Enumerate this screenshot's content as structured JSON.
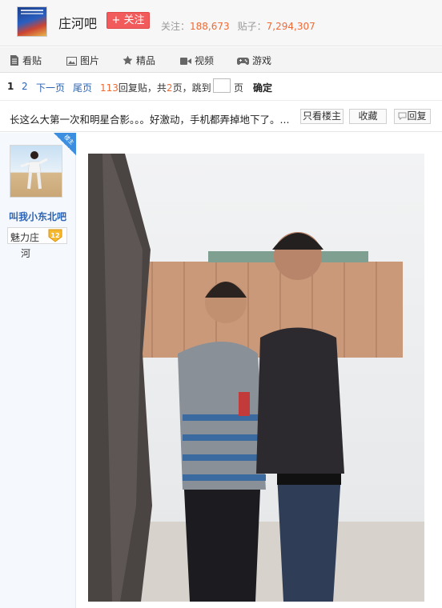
{
  "header": {
    "forum_name": "庄河吧",
    "follow_label": "+ 关注",
    "follow_count_label": "关注：",
    "follow_count": "188,673",
    "post_count_label": "贴子：",
    "post_count": "7,294,307"
  },
  "nav": {
    "items": [
      {
        "label": "看贴",
        "icon": "document-icon"
      },
      {
        "label": "图片",
        "icon": "image-icon"
      },
      {
        "label": "精品",
        "icon": "star-icon"
      },
      {
        "label": "视频",
        "icon": "video-camera-icon"
      },
      {
        "label": "游戏",
        "icon": "gamepad-icon"
      }
    ]
  },
  "pager": {
    "current_page": "1",
    "page_2": "2",
    "next_page": "下一页",
    "last_page": "尾页",
    "reply_count": "113",
    "reply_text": "回复贴，共",
    "total_pages": "2",
    "jump_text": "页，跳到",
    "page_unit": "页",
    "confirm": "确定"
  },
  "thread": {
    "title": "长这么大第一次和明星合影。。。好激动，手机都弄掉地下了。...",
    "only_op_label": "只看楼主",
    "favorite_label": "收藏",
    "reply_label": "回复"
  },
  "author": {
    "louzhu_tag": "楼主",
    "name": "叫我小东北吧",
    "level_name_line1": "魅力庄",
    "level_name_line2": "河",
    "level": "12"
  },
  "colors": {
    "accent_red": "#f25b5b",
    "link_blue": "#2d64b3",
    "number_orange": "#f06a34"
  }
}
